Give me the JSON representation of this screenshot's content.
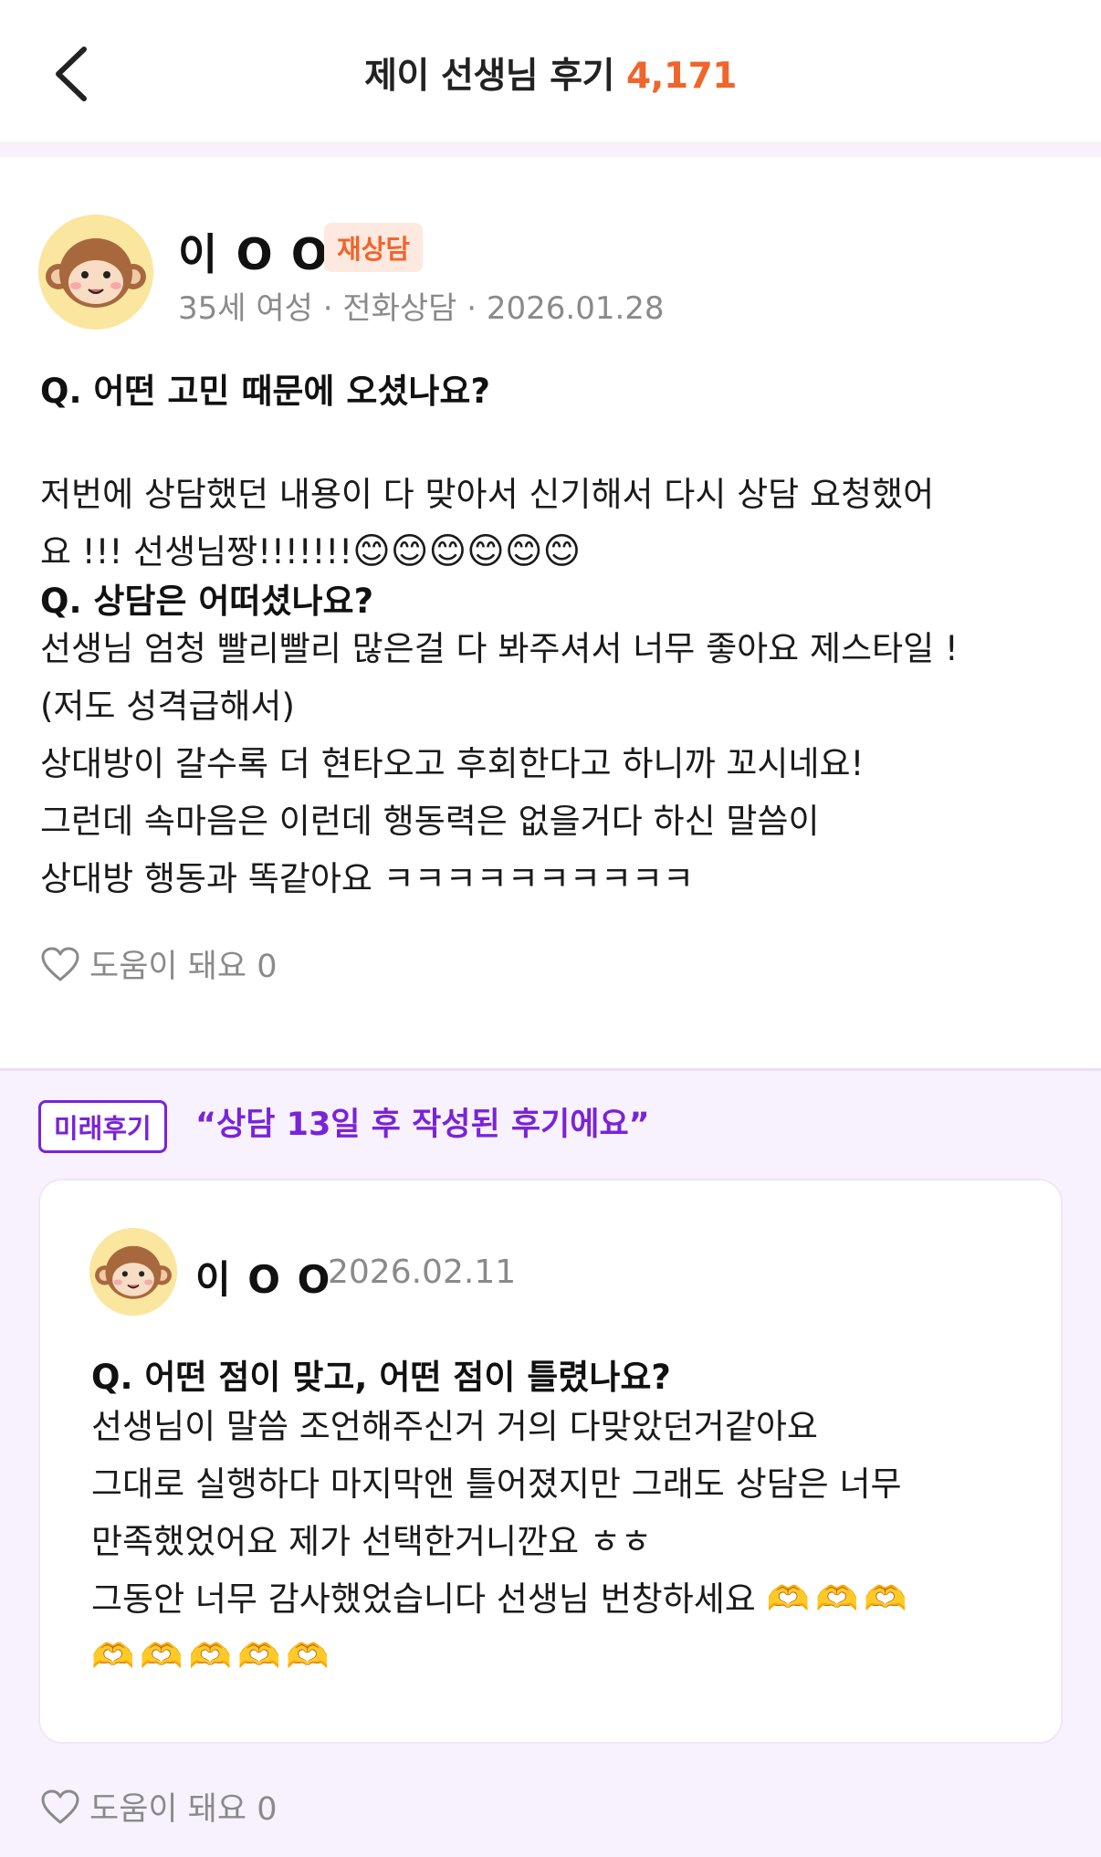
{
  "header": {
    "title": "제이 선생님 후기",
    "count": "4,171"
  },
  "review": {
    "author": "이 O O",
    "badge": "재상담",
    "meta": "35세 여성 · 전화상담 · 2026.01.28",
    "q1": "Q. 어떤 고민 때문에 오셨나요?",
    "a1": "저번에 상담했던 내용이 다 맞아서 신기해서 다시 상담 요청했어\n요 !!! 선생님짱!!!!!!!",
    "a1_emoji": "😊😊😊😊😊😊",
    "q2": "Q. 상담은 어떠셨나요?",
    "a2": "선생님 엄청 빨리빨리 많은걸 다 봐주셔서 너무 좋아요 제스타일 !\n(저도 성격급해서)\n상대방이 갈수록 더 현타오고 후회한다고 하니까 꼬시네요!\n그런데 속마음은 이런데 행동력은 없을거다 하신 말씀이\n상대방 행동과 똑같아요 ㅋㅋㅋㅋㅋㅋㅋㅋㅋㅋ",
    "helpful": "도움이 돼요 0"
  },
  "future": {
    "tag": "미래후기",
    "quote": "“상담 13일 후 작성된 후기에요”",
    "author": "이 O O",
    "date": "2026.02.11",
    "q": "Q. 어떤 점이 맞고, 어떤 점이 틀렸나요?",
    "a": "선생님이 말씀 조언해주신거 거의 다맞았던거같아요\n그대로 실행하다 마지막앤 틀어졌지만 그래도 상담은 너무\n만족했었어요 제가 선택한거니깐요 ㅎㅎ\n그동안 너무 감사했었습니다 선생님 번창하세요",
    "hands_1": "🫶🫶🫶",
    "hands_2": "🫶🫶🫶🫶🫶",
    "helpful": "도움이 돼요 0"
  },
  "colors": {
    "accent_orange": "#f0652c",
    "accent_purple": "#7a23d9",
    "future_bg": "#f8f2fe"
  },
  "icons": {
    "back": "chevron-left-icon",
    "heart": "heart-outline-icon",
    "avatar": "monkey-avatar-icon"
  }
}
